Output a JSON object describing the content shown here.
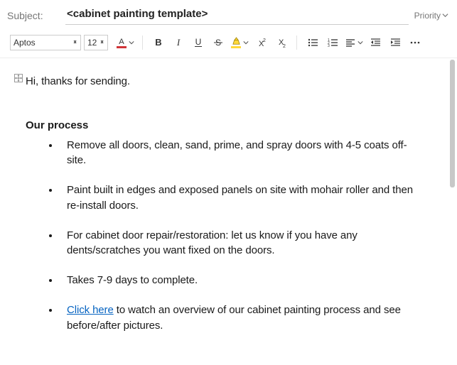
{
  "header": {
    "subject_label": "Subject:",
    "subject_value": "<cabinet painting template>",
    "priority_label": "Priority"
  },
  "toolbar": {
    "font_name": "Aptos",
    "font_size": "12",
    "font_color": "#d13438",
    "highlight_color": "#ffd93b"
  },
  "body": {
    "greeting": "Hi, thanks for sending.",
    "heading": "Our process",
    "bullets": [
      {
        "text": "Remove all doors, clean, sand, prime, and spray doors with 4-5 coats off-site."
      },
      {
        "text": "Paint built in edges and exposed panels on site with mohair roller and then re-install doors."
      },
      {
        "text": "For cabinet door repair/restoration: let us know if you have any dents/scratches you want fixed on the doors."
      },
      {
        "text": "Takes 7-9 days to complete."
      },
      {
        "link_text": "Click here",
        "rest": " to watch an overview of our cabinet painting process and see before/after pictures."
      }
    ]
  }
}
